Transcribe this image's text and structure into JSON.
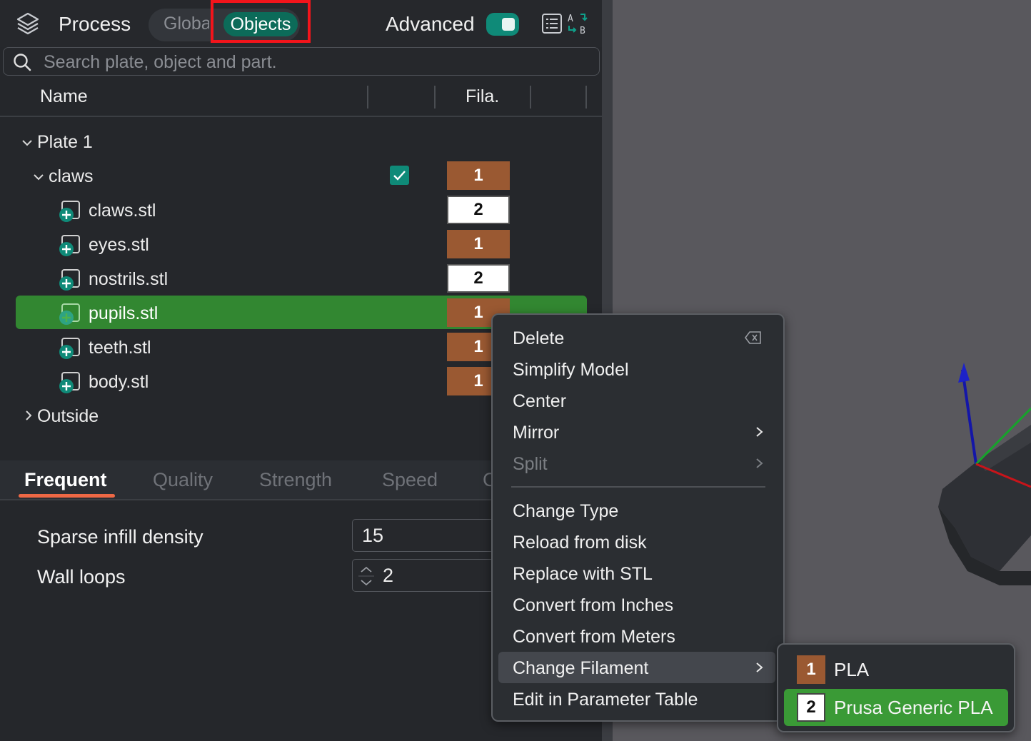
{
  "header": {
    "title": "Process",
    "tabs": [
      {
        "label": "Globa"
      },
      {
        "label": "Objects"
      }
    ],
    "advanced_label": "Advanced",
    "advanced_on": true
  },
  "search": {
    "placeholder": "Search plate, object and part."
  },
  "columns": {
    "name": "Name",
    "filament": "Fila."
  },
  "tree": {
    "plate": "Plate 1",
    "object": {
      "label": "claws",
      "checked": true,
      "filament": "1"
    },
    "parts": [
      {
        "label": "claws.stl",
        "filament": "2"
      },
      {
        "label": "eyes.stl",
        "filament": "1"
      },
      {
        "label": "nostrils.stl",
        "filament": "2"
      },
      {
        "label": "pupils.stl",
        "filament": "1"
      },
      {
        "label": "teeth.stl",
        "filament": "1"
      },
      {
        "label": "body.stl",
        "filament": "1"
      }
    ],
    "outside": "Outside"
  },
  "subtabs": [
    "Frequent",
    "Quality",
    "Strength",
    "Speed",
    "C"
  ],
  "settings": [
    {
      "label": "Sparse infill density",
      "value": "15"
    },
    {
      "label": "Wall loops",
      "value": "2"
    }
  ],
  "context_menu": {
    "items": [
      {
        "label": "Delete"
      },
      {
        "label": "Simplify Model"
      },
      {
        "label": "Center"
      },
      {
        "label": "Mirror"
      },
      {
        "label": "Split"
      },
      {
        "label": "Change Type"
      },
      {
        "label": "Reload from disk"
      },
      {
        "label": "Replace with STL"
      },
      {
        "label": "Convert from Inches"
      },
      {
        "label": "Convert from Meters"
      },
      {
        "label": "Change Filament"
      },
      {
        "label": "Edit in Parameter Table"
      }
    ]
  },
  "filament_submenu": [
    {
      "number": "1",
      "label": "PLA",
      "color": "#9a5932"
    },
    {
      "number": "2",
      "label": "Prusa Generic PLA",
      "color": "#ffffff"
    }
  ],
  "colors": {
    "accent": "#0c6b59",
    "selection": "#328731",
    "highlight_box": "#f3141b",
    "filament_1": "#9a5932",
    "filament_2": "#ffffff"
  }
}
